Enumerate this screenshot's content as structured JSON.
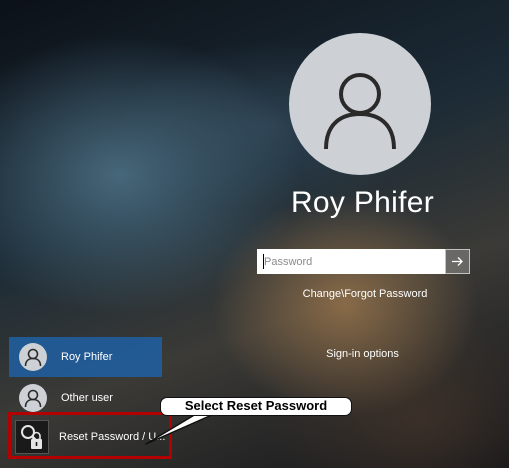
{
  "login": {
    "user_name": "Roy Phifer",
    "password_placeholder": "Password",
    "change_password_link": "Change\\Forgot Password",
    "signin_options": "Sign-in options"
  },
  "user_list": [
    {
      "label": "Roy Phifer",
      "selected": true,
      "icon": "user-avatar-icon"
    },
    {
      "label": "Other user",
      "selected": false,
      "icon": "user-avatar-icon"
    },
    {
      "label": "Reset Password / U...",
      "selected": false,
      "icon": "key-lock-icon"
    }
  ],
  "annotation": {
    "callout_text": "Select Reset Password"
  },
  "colors": {
    "selected_tile": "#205ea0",
    "avatar_bg": "#cdd1d5",
    "highlight": "#b30000"
  }
}
